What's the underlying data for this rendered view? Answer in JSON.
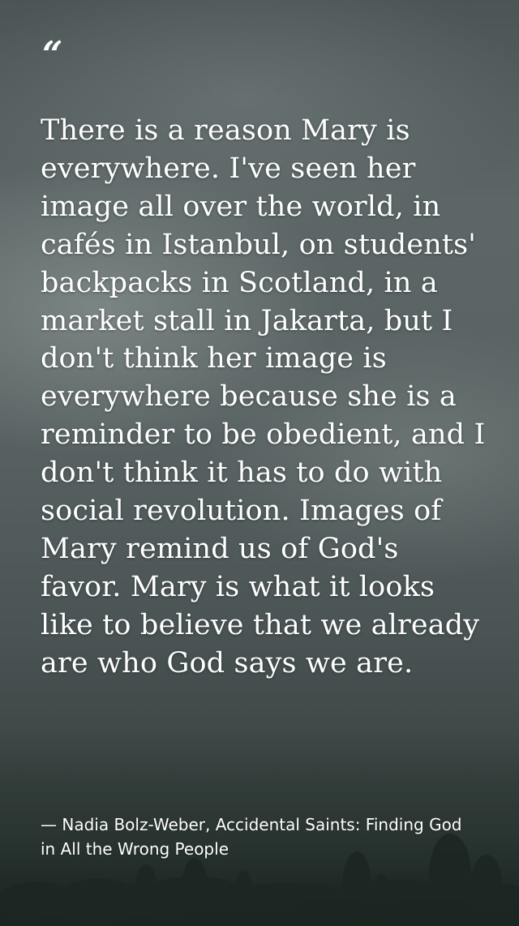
{
  "quote": {
    "mark": "“",
    "text": "There is a reason Mary is everywhere. I've seen her image all over the world, in cafés in Istanbul, on students' backpacks in Scotland, in a market stall in Jakarta, but I don't think her image is everywhere because she is a reminder to be obedient, and I don't think it has to do with social revolution. Images of Mary remind us of God's favor. Mary is what it looks like to believe that we already are who God says we are.",
    "attribution": "— Nadia Bolz-Weber, Accidental Saints: Finding God in All the Wrong People"
  },
  "colors": {
    "text": "#ffffff",
    "background": "#4b5555"
  }
}
